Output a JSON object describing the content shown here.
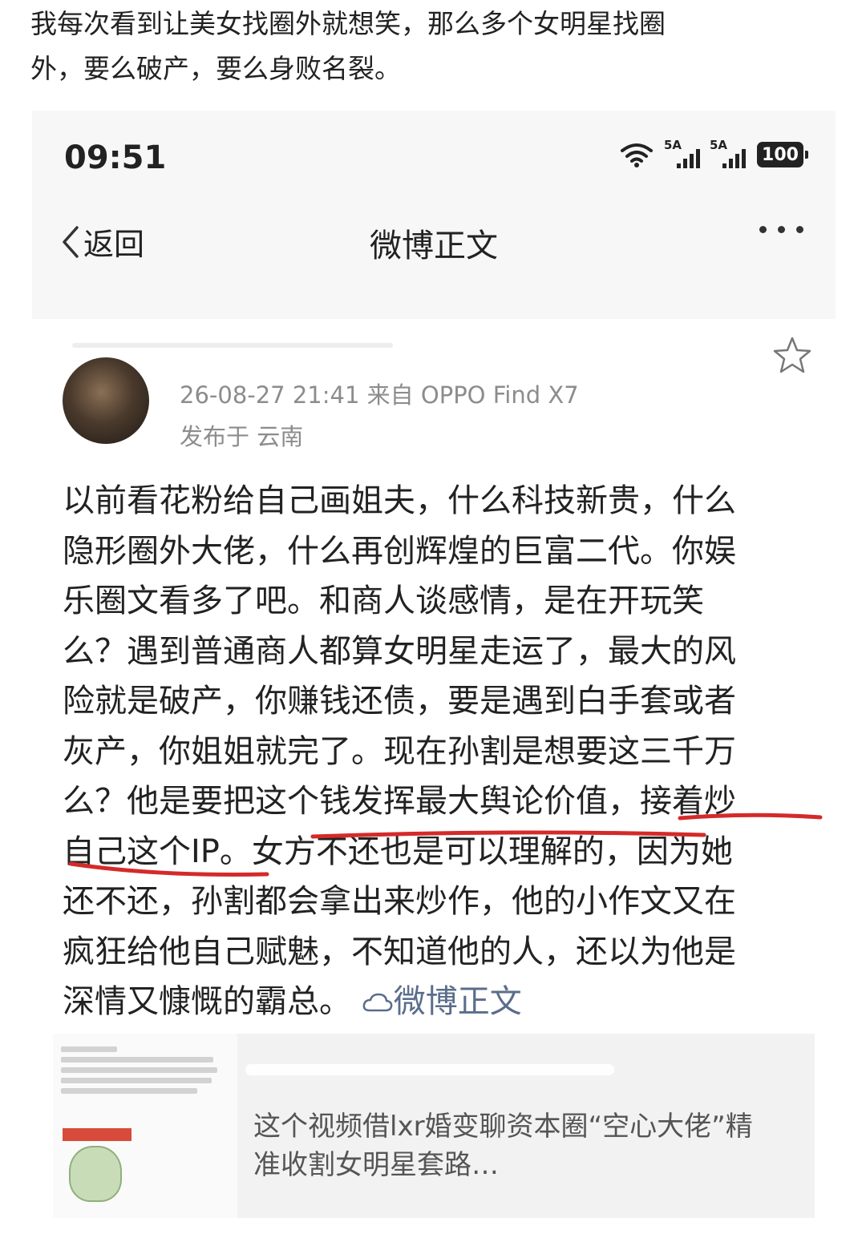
{
  "caption": {
    "line1": "我每次看到让美女找圈外就想笑，那么多个女明星找圈",
    "line2": "外，要么破产，要么身败名裂。"
  },
  "status_bar": {
    "time": "09:51",
    "signal1": "5A",
    "signal2": "5A",
    "battery": "100"
  },
  "nav": {
    "back_label": "返回",
    "title": "微博正文"
  },
  "post": {
    "timestamp": "26-08-27 21:41",
    "source": "来自 OPPO Find X7",
    "location": "发布于 云南",
    "lines": [
      "以前看花粉给自己画姐夫，什么科技新贵，什么",
      "隐形圈外大佬，什么再创辉煌的巨富二代。你娱",
      "乐圈文看多了吧。和商人谈感情，是在开玩笑",
      "么？遇到普通商人都算女明星走运了，最大的风",
      "险就是破产，你赚钱还债，要是遇到白手套或者",
      "灰产，你姐姐就完了。现在孙割是想要这三千万",
      "么？他是要把这个钱发挥最大舆论价值，接着炒",
      "自己这个IP。女方不还也是可以理解的，因为她",
      "还不还，孙割都会拿出来炒作，他的小作文又在",
      "疯狂给他自己赋魅，不知道他的人，还以为他是",
      "深情又慷慨的霸总。"
    ],
    "link_label": "微博正文"
  },
  "share_card": {
    "text": "这个视频借lxr婚变聊资本圈“空心大佬”精准收割女明星套路…"
  }
}
